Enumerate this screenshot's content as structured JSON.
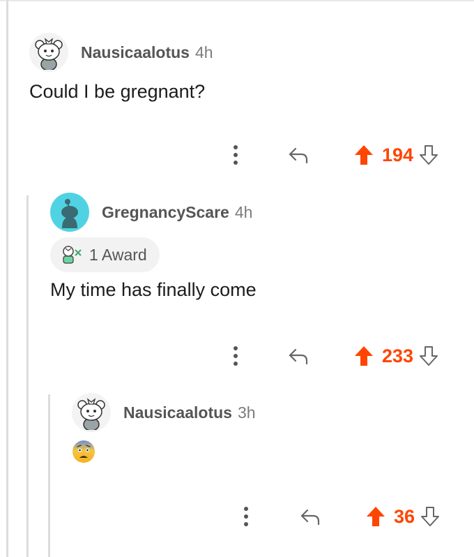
{
  "colors": {
    "upvote": "#ff4500",
    "username": "#555555",
    "timestamp": "#7c7c7c",
    "thread_line": "#dcdcdc",
    "avatar_teal": "#4fd3e3"
  },
  "comments": [
    {
      "username": "Nausicaalotus",
      "time": "4h",
      "body": "Could I be gregnant?",
      "score": "194",
      "avatar_icon": "snoo-avatar-icon"
    },
    {
      "username": "GregnancyScare",
      "time": "4h",
      "award": "1 Award",
      "body": "My time has finally come",
      "score": "233",
      "avatar_icon": "default-snoo-avatar-icon"
    },
    {
      "username": "Nausicaalotus",
      "time": "3h",
      "body_emoji": "fearful-face-emoji",
      "score": "36",
      "avatar_icon": "snoo-avatar-icon"
    }
  ]
}
